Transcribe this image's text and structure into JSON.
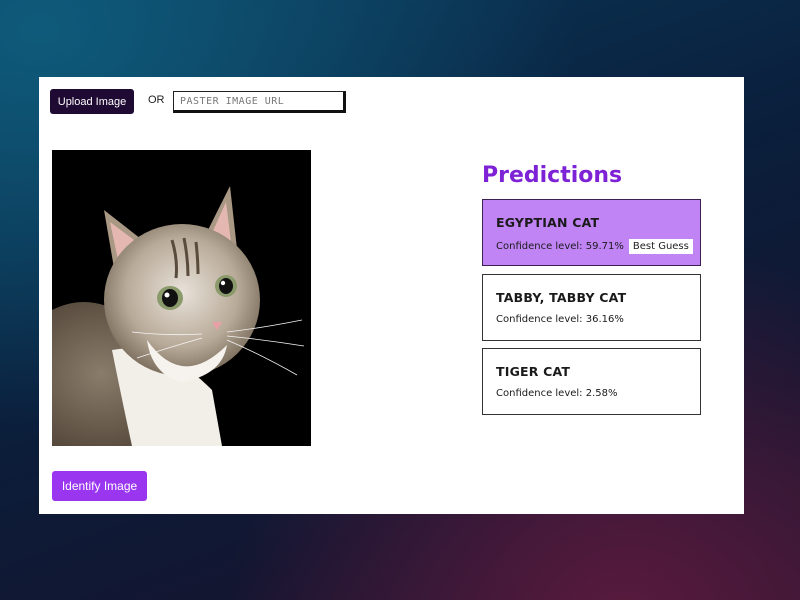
{
  "toolbar": {
    "upload_label": "Upload Image",
    "or_label": "OR",
    "url_placeholder": "PASTER IMAGE URL"
  },
  "actions": {
    "identify_label": "Identify Image"
  },
  "predictions": {
    "title": "Predictions",
    "items": [
      {
        "name": "EGYPTIAN CAT",
        "confidence": "Confidence level: 59.71%",
        "badge": "Best Guess"
      },
      {
        "name": "TABBY, TABBY CAT",
        "confidence": "Confidence level: 36.16%"
      },
      {
        "name": "TIGER CAT",
        "confidence": "Confidence level: 2.58%"
      }
    ]
  },
  "colors": {
    "upload_button": "#1f0a33",
    "identify_button": "#9a36f0",
    "title": "#7e22d6",
    "best_guess_card": "#c084f5"
  }
}
